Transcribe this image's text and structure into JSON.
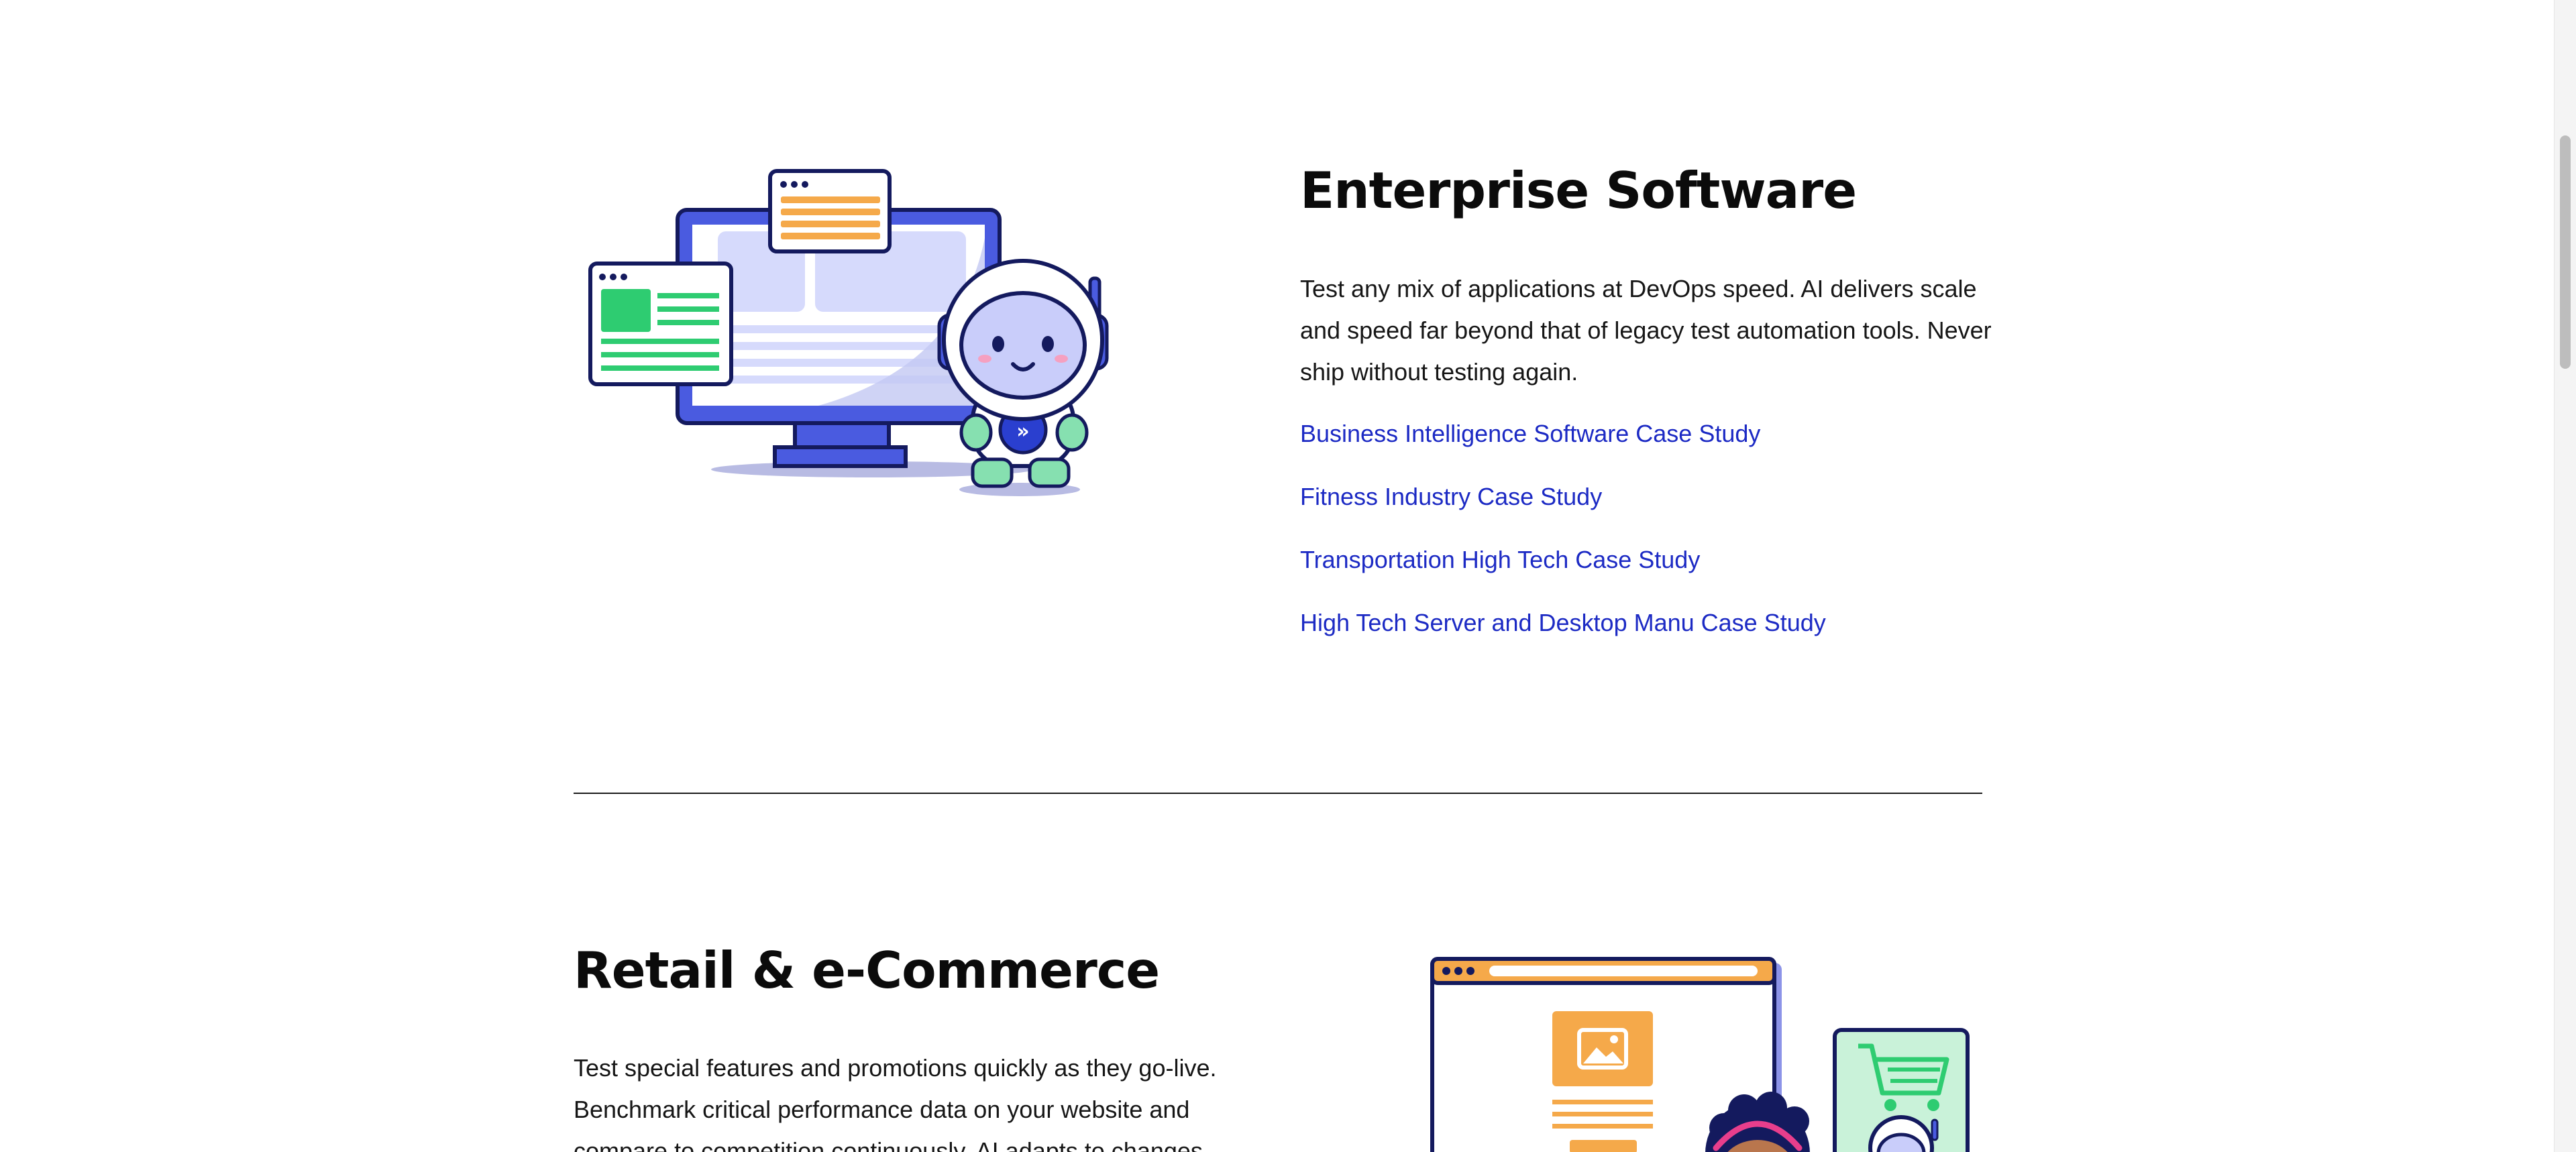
{
  "enterprise": {
    "title": "Enterprise Software",
    "description": "Test any mix of applications at DevOps speed. AI delivers scale and speed far beyond that of legacy test automation tools. Never ship without testing again.",
    "links": [
      "Business Intelligence Software Case Study",
      "Fitness Industry Case Study",
      "Transportation High Tech Case Study",
      "High Tech Server and Desktop Manu Case Study"
    ],
    "illustration": "monitor-astronaut-illustration"
  },
  "retail": {
    "title": "Retail & e-Commerce",
    "description": "Test special features and promotions quickly as they go-live. Benchmark critical performance data on your website and compare to competition continuously. AI adapts to changes",
    "illustration": "shop-astronaut-illustration"
  },
  "colors": {
    "link": "#1c2ac4",
    "illustration_blue": "#4a5be0",
    "illustration_navy": "#141a5e",
    "illustration_orange": "#f5a94a",
    "illustration_green": "#2ecc71",
    "illustration_light": "#d6dafc"
  }
}
